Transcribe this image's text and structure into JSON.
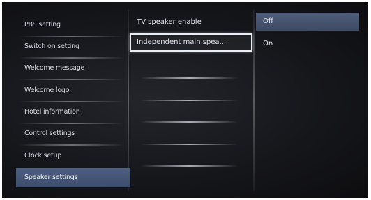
{
  "menu": {
    "left_items": [
      {
        "label": "PBS setting"
      },
      {
        "label": "Switch on setting"
      },
      {
        "label": "Welcome message"
      },
      {
        "label": "Welcome logo"
      },
      {
        "label": "Hotel information"
      },
      {
        "label": "Control settings"
      },
      {
        "label": "Clock setup"
      },
      {
        "label": "Speaker settings",
        "selected": true
      }
    ],
    "middle_items": [
      {
        "label": "TV speaker enable"
      },
      {
        "label": "Independent main spea...",
        "focused": true
      }
    ],
    "middle_blank_rows": 6,
    "right_options": [
      {
        "label": "Off",
        "current": true
      },
      {
        "label": "On"
      }
    ]
  },
  "colors": {
    "selection": "#44557a",
    "focus_border": "#e9eef5",
    "background": "#16171b"
  }
}
